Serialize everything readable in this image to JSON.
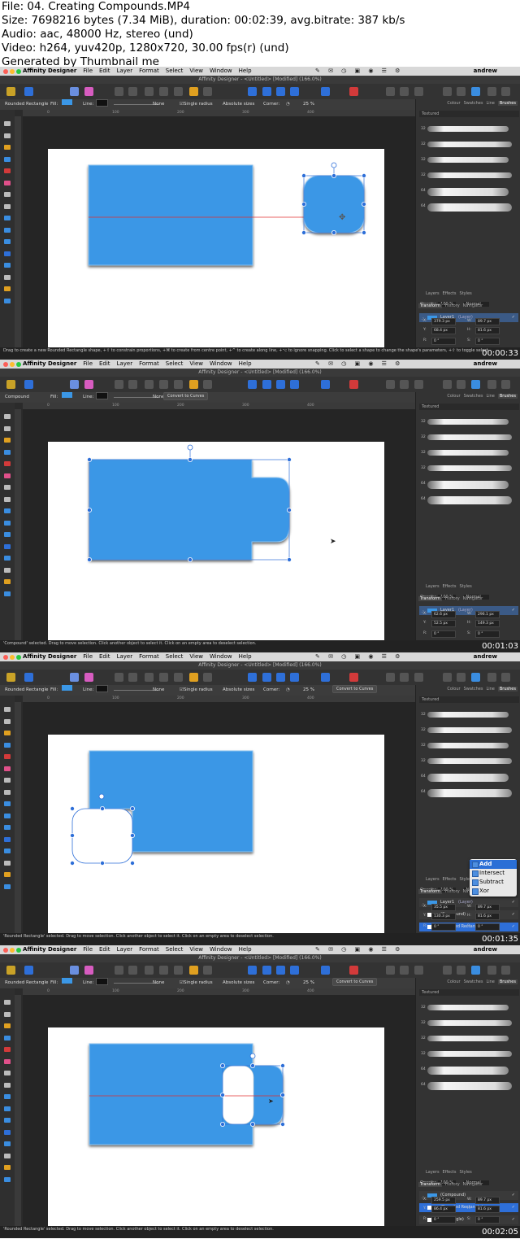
{
  "header": {
    "lines": [
      "File: 04. Creating Compounds.MP4",
      "Size: 7698216 bytes (7.34 MiB), duration: 00:02:39, avg.bitrate: 387 kb/s",
      "Audio: aac, 48000 Hz, stereo (und)",
      "Video: h264, yuv420p, 1280x720, 30.00 fps(r) (und)",
      "Generated by Thumbnail me"
    ]
  },
  "app": {
    "name": "Affinity Designer",
    "menus": [
      "File",
      "Edit",
      "Layer",
      "Format",
      "Select",
      "View",
      "Window",
      "Help"
    ],
    "user": "andrew",
    "window_title": "Affinity Designer - <Untitled> [Modified] (166.0%)",
    "colors": {
      "accent": "#2e6fd8",
      "shape_fill": "#3b97e6",
      "handle": "#2e6fd8",
      "guide": "#e03030"
    }
  },
  "ruler": [
    "0",
    "100",
    "200",
    "300",
    "400"
  ],
  "panel": {
    "tabs": [
      "Colour",
      "Swatches",
      "Line",
      "Brushes"
    ],
    "brush_category": "Textured",
    "brush_sizes": [
      "32",
      "32",
      "32",
      "32",
      "64",
      "64"
    ],
    "section_tabs": [
      "Layers",
      "Effects",
      "Styles"
    ],
    "opacity_label": "Opacity:",
    "opacity_value": "100 %",
    "blend_mode": "Normal",
    "bottom_tabs": [
      "Transform",
      "History",
      "Navigator"
    ]
  },
  "frames": [
    {
      "timestamp": "00:00:33",
      "ctx": {
        "label": "Rounded Rectangle",
        "fill": "Fill:",
        "line": "Line:",
        "none": "None",
        "single_radius": "Single radius",
        "absolute_sizes": "Absolute sizes",
        "corner": "Corner:",
        "corner_val": "25 %",
        "convert": ""
      },
      "layers": [
        {
          "name": "Layer1",
          "kind": "(Layer)",
          "selected": true
        }
      ],
      "transform": {
        "x": "379.3 px",
        "y": "68.4 px",
        "w": "89.7 px",
        "h": "81.6 px",
        "r": "0 °",
        "s": "0 °"
      },
      "status": "Drag to create a new Rounded Rectangle shape, +⇧ to constrain proportions, +⌘ to create from centre point, +^ to create along line, +⌥ to ignore snapping. Click to select a shape to change the shape's parameters, +⇧ to toggle select"
    },
    {
      "timestamp": "00:01:03",
      "ctx": {
        "label": "Compound",
        "fill": "Fill:",
        "line": "Line:",
        "none": "None",
        "single_radius": "",
        "absolute_sizes": "",
        "corner": "",
        "corner_val": "",
        "convert": "Convert to Curves"
      },
      "layers": [
        {
          "name": "Layer1",
          "kind": "(Layer)",
          "selected": true
        }
      ],
      "transform": {
        "x": "62.6 px",
        "y": "52.5 px",
        "w": "296.1 px",
        "h": "149.3 px",
        "r": "0 °",
        "s": "0 °"
      },
      "status": "'Compound' selected. Drag to move selection. Click another object to select it. Click on an empty area to deselect selection."
    },
    {
      "timestamp": "00:01:35",
      "ctx": {
        "label": "Rounded Rectangle",
        "fill": "Fill:",
        "line": "Line:",
        "none": "None",
        "single_radius": "Single radius",
        "absolute_sizes": "Absolute sizes",
        "corner": "Corner:",
        "corner_val": "25 %",
        "convert": "Convert to Curves"
      },
      "layers": [
        {
          "name": "Layer1",
          "kind": "(Layer)",
          "selected": false
        },
        {
          "name": "(Compound)",
          "kind": "",
          "selected": false
        },
        {
          "name": "(Rounded Rectangle)",
          "kind": "",
          "selected": true
        },
        {
          "name": "(Rectangle)",
          "kind": "",
          "selected": false
        }
      ],
      "menu": [
        "Add",
        "Intersect",
        "Subtract",
        "Xor"
      ],
      "transform": {
        "x": "35.5 px",
        "y": "130.3 px",
        "w": "89.7 px",
        "h": "81.6 px",
        "r": "0 °",
        "s": "0 °"
      },
      "status": "'Rounded Rectangle' selected. Drag to move selection. Click another object to select it. Click on an empty area to deselect selection."
    },
    {
      "timestamp": "00:02:05",
      "ctx": {
        "label": "Rounded Rectangle",
        "fill": "Fill:",
        "line": "Line:",
        "none": "None",
        "single_radius": "Single radius",
        "absolute_sizes": "Absolute sizes",
        "corner": "Corner:",
        "corner_val": "25 %",
        "convert": "Convert to Curves"
      },
      "layers": [
        {
          "name": "(Compound)",
          "kind": "",
          "selected": false
        },
        {
          "name": "(Rounded Rectangle)",
          "kind": "",
          "selected": true
        },
        {
          "name": "(Rectangle)",
          "kind": "",
          "selected": false
        }
      ],
      "transform": {
        "x": "259.5 px",
        "y": "86.4 px",
        "w": "89.7 px",
        "h": "81.6 px",
        "r": "0 °",
        "s": "0 °"
      },
      "status": "'Rounded Rectangle' selected. Drag to move selection. Click another object to select it. Click on an empty area to deselect selection."
    }
  ]
}
